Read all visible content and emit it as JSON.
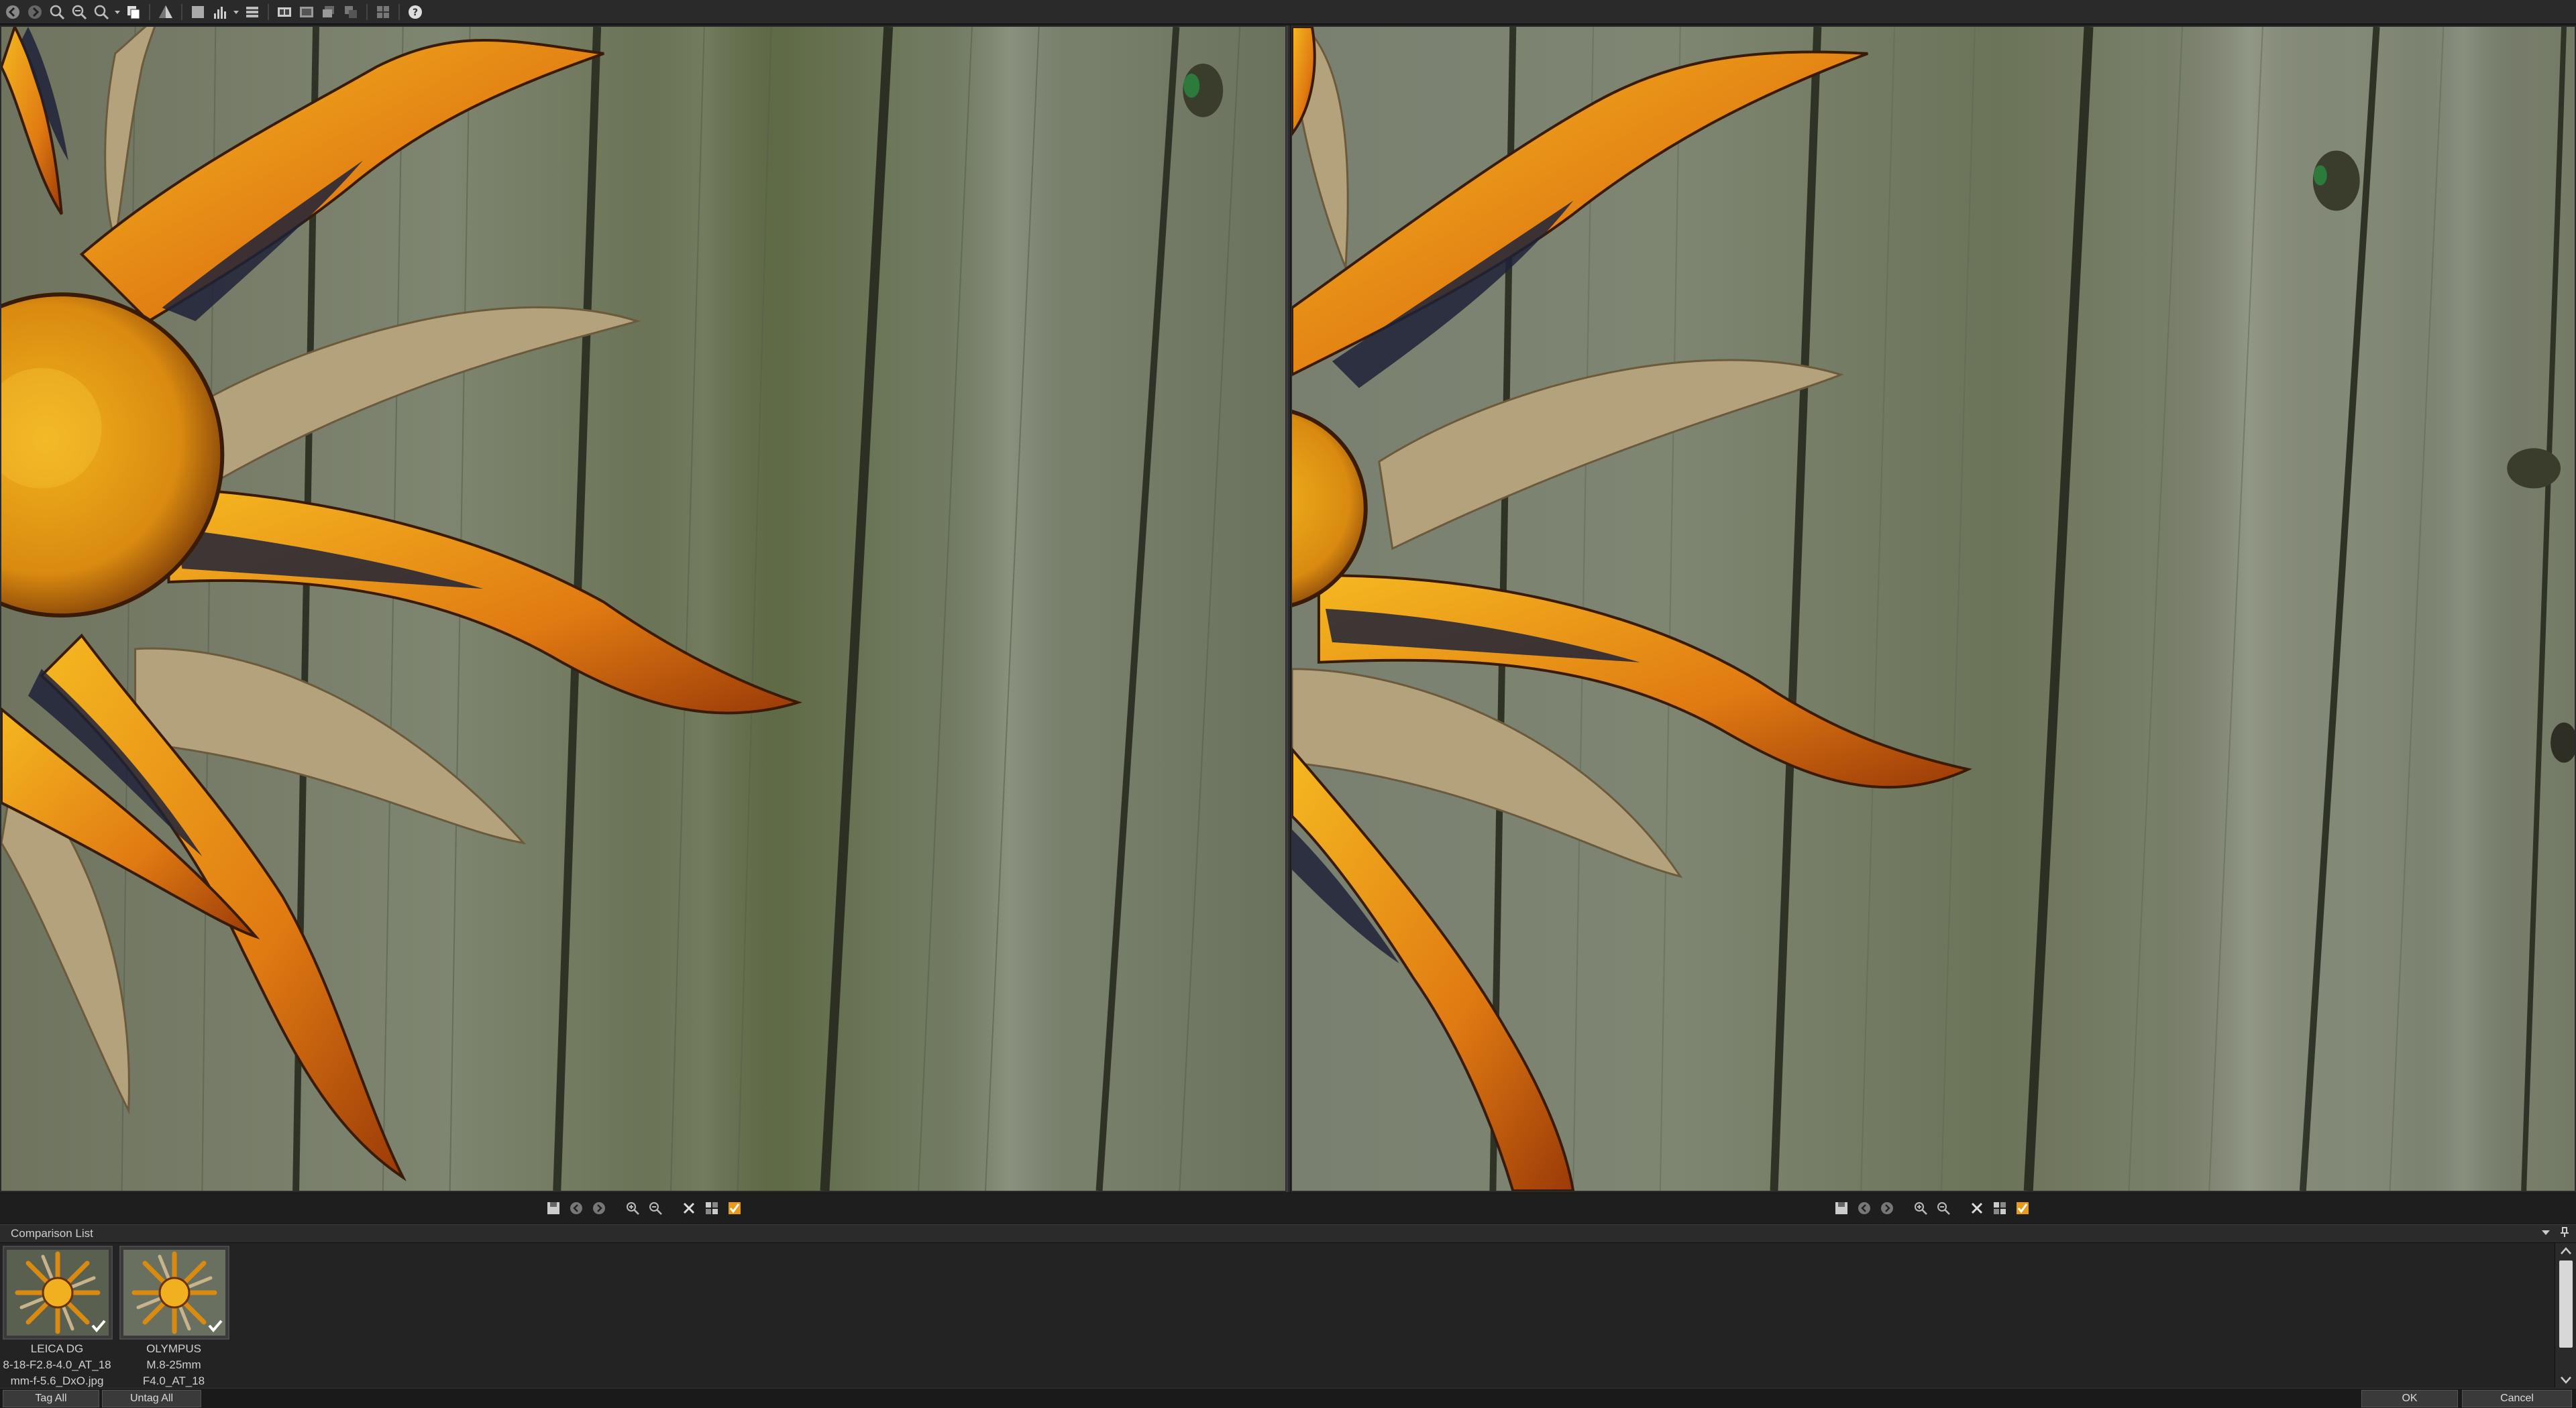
{
  "toolbar": {
    "icons": [
      "back-icon",
      "forward-icon",
      "zoom-fit-icon",
      "zoom-in-icon",
      "zoom-out-icon",
      "zoom-dropdown-icon",
      "copy-icon",
      "sharpen-icon",
      "square-icon",
      "histogram-icon",
      "menu-icon",
      "film-icon",
      "compare-icon",
      "stack-icon",
      "layers-icon",
      "grid-icon",
      "help-icon"
    ]
  },
  "comparison_list": {
    "title": "Comparison List",
    "items": [
      {
        "line1": "LEICA DG",
        "line2": "8-18-F2.8-4.0_AT_18",
        "line3": "mm-f-5.6_DxO.jpg",
        "tagged": true
      },
      {
        "line1": "OLYMPUS",
        "line2": "M.8-25mm",
        "line3": "F4.0_AT_18",
        "tagged": true
      }
    ]
  },
  "buttons": {
    "tag_all": "Tag All",
    "untag_all": "Untag All",
    "ok": "OK",
    "cancel": "Cancel"
  },
  "colors": {
    "accent": "#e89a1a",
    "wood": "#6b7160",
    "panel": "#232323"
  }
}
